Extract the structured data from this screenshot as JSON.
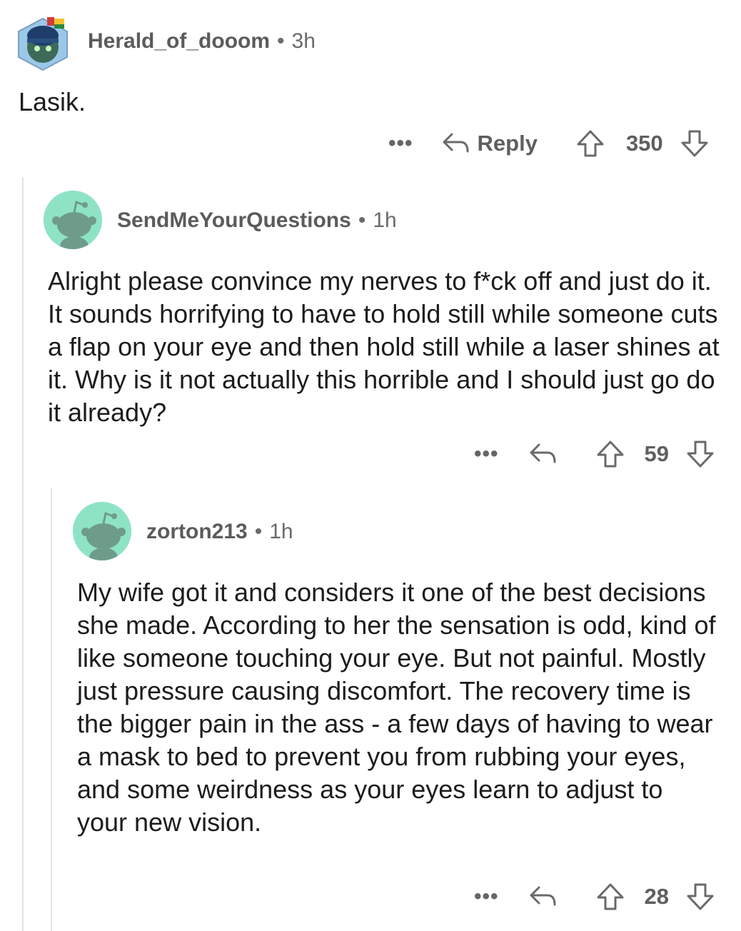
{
  "comments": [
    {
      "username": "Herald_of_dooom",
      "separator": "•",
      "time": "3h",
      "body": "Lasik.",
      "more": "•••",
      "reply_label": "Reply",
      "score": "350",
      "avatar_icon": "helmeted-snoo-avatar-icon"
    },
    {
      "username": "SendMeYourQuestions",
      "separator": "•",
      "time": "1h",
      "body": "Alright please convince my nerves to f*ck off and just do it. It sounds horrifying to have to hold still while someone cuts a flap on your eye and then hold still while a laser shines at it. Why is it not actually this horrible and I should just go do it already?",
      "more": "•••",
      "score": "59",
      "avatar_icon": "default-snoo-avatar-icon"
    },
    {
      "username": "zorton213",
      "separator": "•",
      "time": "1h",
      "body": "My wife got it and considers it one of the best decisions she made. According to her the sensation is odd, kind of like someone touching your eye. But not painful. Mostly just pressure causing discomfort. The recovery time is the bigger pain in the ass - a few days of having to wear a mask to bed to prevent you from rubbing your eyes, and some weirdness as your eyes learn to adjust to your new vision.",
      "more": "•••",
      "score": "28",
      "avatar_icon": "default-snoo-avatar-icon"
    }
  ],
  "colors": {
    "avatar_bg": "#8fe3c5",
    "snoo": "#6f9c8a",
    "meta_text": "#6b6b6b",
    "body_text": "#1c1c1c",
    "thread_line": "#e4e4e4"
  }
}
